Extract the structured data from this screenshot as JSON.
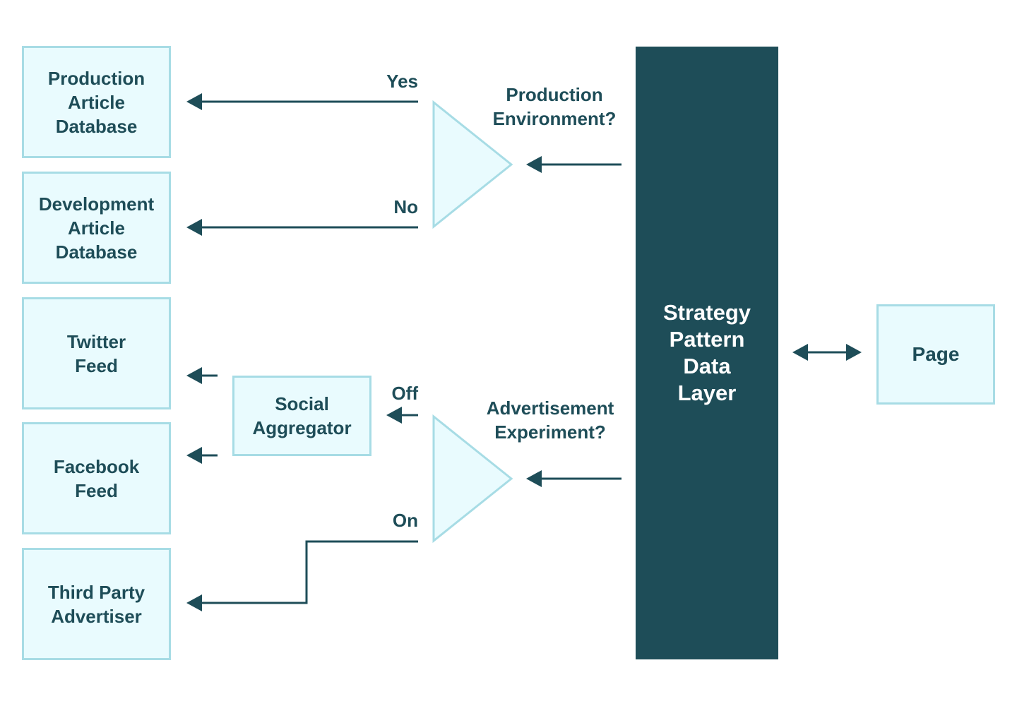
{
  "colors": {
    "primary_dark": "#1e4d58",
    "box_fill": "#e9fbfe",
    "box_border": "#a7dce5",
    "bar_text": "#ffffff"
  },
  "data_sources": [
    {
      "id": "prod-db",
      "label": "Production\nArticle\nDatabase"
    },
    {
      "id": "dev-db",
      "label": "Development\nArticle\nDatabase"
    },
    {
      "id": "twitter",
      "label": "Twitter\nFeed"
    },
    {
      "id": "facebook",
      "label": "Facebook\nFeed"
    },
    {
      "id": "advertiser",
      "label": "Third Party\nAdvertiser"
    }
  ],
  "social_aggregator": {
    "label": "Social\nAggregator"
  },
  "decisions": [
    {
      "id": "env",
      "question": "Production\nEnvironment?",
      "branch_top": "Yes",
      "branch_bottom": "No"
    },
    {
      "id": "ad",
      "question": "Advertisement\nExperiment?",
      "branch_top": "Off",
      "branch_bottom": "On"
    }
  ],
  "strategy_layer": {
    "label": "Strategy\nPattern\nData\nLayer"
  },
  "page": {
    "label": "Page"
  }
}
